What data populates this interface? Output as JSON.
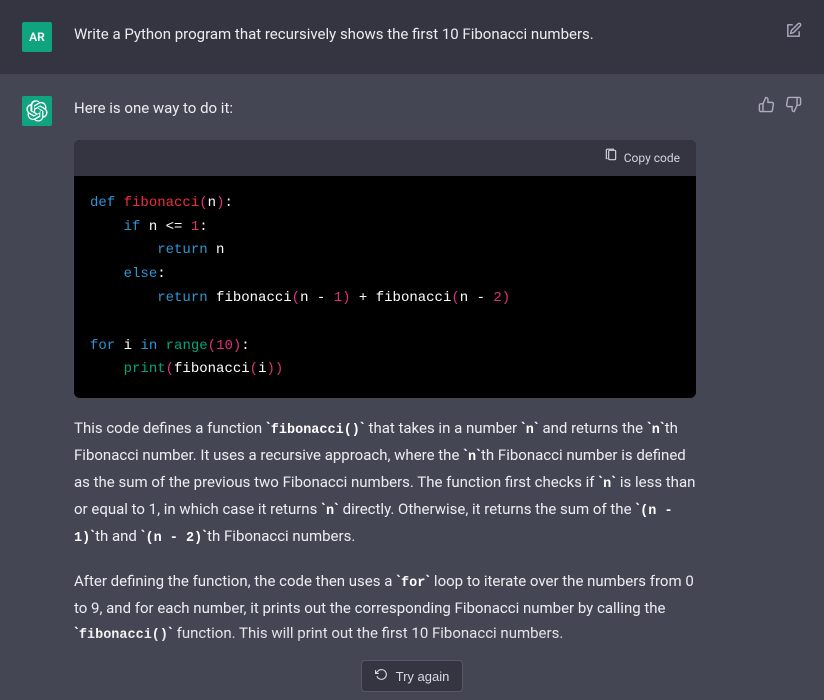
{
  "user": {
    "avatar_initials": "AR",
    "prompt": "Write a Python program that recursively shows the first 10 Fibonacci numbers."
  },
  "assistant": {
    "intro": "Here is one way to do it:",
    "copy_label": "Copy code",
    "code_tokens": [
      [
        [
          "kw",
          "def"
        ],
        [
          "sp",
          " "
        ],
        [
          "fn",
          "fibonacci"
        ],
        [
          "paren",
          "("
        ],
        [
          "id",
          "n"
        ],
        [
          "paren",
          ")"
        ],
        [
          "op",
          ":"
        ]
      ],
      [
        [
          "sp",
          "    "
        ],
        [
          "kw",
          "if"
        ],
        [
          "sp",
          " "
        ],
        [
          "id",
          "n"
        ],
        [
          "sp",
          " "
        ],
        [
          "op",
          "<="
        ],
        [
          "sp",
          " "
        ],
        [
          "num",
          "1"
        ],
        [
          "op",
          ":"
        ]
      ],
      [
        [
          "sp",
          "        "
        ],
        [
          "kw",
          "return"
        ],
        [
          "sp",
          " "
        ],
        [
          "id",
          "n"
        ]
      ],
      [
        [
          "sp",
          "    "
        ],
        [
          "kw",
          "else"
        ],
        [
          "op",
          ":"
        ]
      ],
      [
        [
          "sp",
          "        "
        ],
        [
          "kw",
          "return"
        ],
        [
          "sp",
          " "
        ],
        [
          "id",
          "fibonacci"
        ],
        [
          "paren",
          "("
        ],
        [
          "id",
          "n"
        ],
        [
          "sp",
          " "
        ],
        [
          "op",
          "-"
        ],
        [
          "sp",
          " "
        ],
        [
          "num",
          "1"
        ],
        [
          "paren",
          ")"
        ],
        [
          "sp",
          " "
        ],
        [
          "op",
          "+"
        ],
        [
          "sp",
          " "
        ],
        [
          "id",
          "fibonacci"
        ],
        [
          "paren",
          "("
        ],
        [
          "id",
          "n"
        ],
        [
          "sp",
          " "
        ],
        [
          "op",
          "-"
        ],
        [
          "sp",
          " "
        ],
        [
          "num",
          "2"
        ],
        [
          "paren",
          ")"
        ]
      ],
      [],
      [
        [
          "kw",
          "for"
        ],
        [
          "sp",
          " "
        ],
        [
          "id",
          "i"
        ],
        [
          "sp",
          " "
        ],
        [
          "kw",
          "in"
        ],
        [
          "sp",
          " "
        ],
        [
          "builtin",
          "range"
        ],
        [
          "paren",
          "("
        ],
        [
          "num",
          "10"
        ],
        [
          "paren",
          ")"
        ],
        [
          "op",
          ":"
        ]
      ],
      [
        [
          "sp",
          "    "
        ],
        [
          "builtin",
          "print"
        ],
        [
          "paren",
          "("
        ],
        [
          "id",
          "fibonacci"
        ],
        [
          "paren",
          "("
        ],
        [
          "id",
          "i"
        ],
        [
          "paren",
          ")"
        ],
        [
          "paren",
          ")"
        ]
      ]
    ],
    "paragraph1": [
      {
        "t": "text",
        "v": "This code defines a function "
      },
      {
        "t": "code",
        "v": "fibonacci()"
      },
      {
        "t": "text",
        "v": " that takes in a number "
      },
      {
        "t": "code",
        "v": "n"
      },
      {
        "t": "text",
        "v": " and returns the "
      },
      {
        "t": "code",
        "v": "n"
      },
      {
        "t": "text",
        "v": "th Fibonacci number. It uses a recursive approach, where the "
      },
      {
        "t": "code",
        "v": "n"
      },
      {
        "t": "text",
        "v": "th Fibonacci number is defined as the sum of the previous two Fibonacci numbers. The function first checks if "
      },
      {
        "t": "code",
        "v": "n"
      },
      {
        "t": "text",
        "v": " is less than or equal to 1, in which case it returns "
      },
      {
        "t": "code",
        "v": "n"
      },
      {
        "t": "text",
        "v": " directly. Otherwise, it returns the sum of the "
      },
      {
        "t": "code",
        "v": "(n - 1)"
      },
      {
        "t": "text",
        "v": "th and "
      },
      {
        "t": "code",
        "v": "(n - 2)"
      },
      {
        "t": "text",
        "v": "th Fibonacci numbers."
      }
    ],
    "paragraph2": [
      {
        "t": "text",
        "v": "After defining the function, the code then uses a "
      },
      {
        "t": "code",
        "v": "for"
      },
      {
        "t": "text",
        "v": " loop to iterate over the numbers from 0 to 9, and for each number, it prints out the corresponding Fibonacci number by calling the "
      },
      {
        "t": "code",
        "v": "fibonacci()"
      },
      {
        "t": "text",
        "v": " function. This will print out the first 10 Fibonacci numbers."
      }
    ]
  },
  "footer": {
    "try_again": "Try again"
  }
}
